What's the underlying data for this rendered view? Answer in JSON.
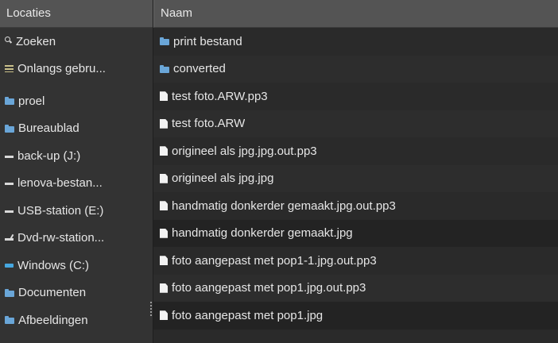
{
  "sidebar": {
    "header": "Locaties",
    "items": [
      {
        "label": "Zoeken",
        "icon": "search-icon"
      },
      {
        "label": "Onlangs gebru...",
        "icon": "recent-icon"
      },
      {
        "label": "proel",
        "icon": "folder-icon"
      },
      {
        "label": "Bureaublad",
        "icon": "folder-icon"
      },
      {
        "label": "back-up (J:)",
        "icon": "drive-icon"
      },
      {
        "label": "lenova-bestan...",
        "icon": "drive-icon"
      },
      {
        "label": "USB-station (E:)",
        "icon": "drive-icon"
      },
      {
        "label": "Dvd-rw-station...",
        "icon": "dvd-icon"
      },
      {
        "label": "Windows (C:)",
        "icon": "windows-icon"
      },
      {
        "label": "Documenten",
        "icon": "folder-icon"
      },
      {
        "label": "Afbeeldingen",
        "icon": "folder-icon"
      }
    ]
  },
  "files": {
    "header": "Naam",
    "items": [
      {
        "label": "print bestand",
        "icon": "folder-icon"
      },
      {
        "label": "converted",
        "icon": "folder-icon"
      },
      {
        "label": "test foto.ARW.pp3",
        "icon": "file-icon"
      },
      {
        "label": "test foto.ARW",
        "icon": "file-icon"
      },
      {
        "label": "origineel als jpg.jpg.out.pp3",
        "icon": "file-icon"
      },
      {
        "label": "origineel als jpg.jpg",
        "icon": "file-icon"
      },
      {
        "label": "handmatig donkerder gemaakt.jpg.out.pp3",
        "icon": "file-icon"
      },
      {
        "label": "handmatig donkerder gemaakt.jpg",
        "icon": "file-icon"
      },
      {
        "label": "foto aangepast met pop1-1.jpg.out.pp3",
        "icon": "file-icon"
      },
      {
        "label": "foto aangepast met pop1.jpg.out.pp3",
        "icon": "file-icon"
      },
      {
        "label": "foto aangepast met pop1.jpg",
        "icon": "file-icon"
      }
    ]
  }
}
